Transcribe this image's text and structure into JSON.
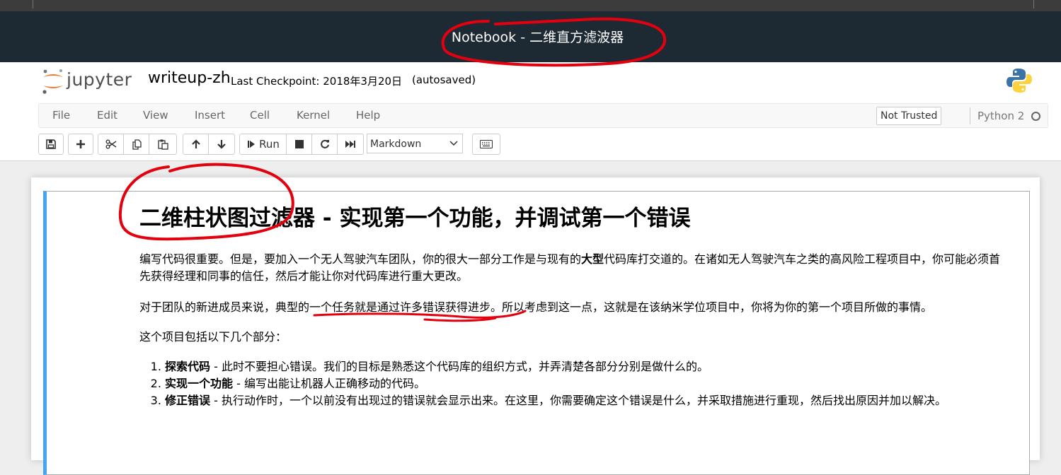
{
  "window": {
    "title": "Notebook - 二维直方滤波器"
  },
  "header": {
    "logo_text": "jupyter",
    "notebook_name": "writeup-zh",
    "checkpoint": "Last Checkpoint: 2018年3月20日",
    "autosave": "(autosaved)"
  },
  "menubar": {
    "items": [
      "File",
      "Edit",
      "View",
      "Insert",
      "Cell",
      "Kernel",
      "Help"
    ],
    "trust_label": "Not Trusted",
    "kernel_name": "Python 2"
  },
  "toolbar": {
    "run_label": "Run",
    "cell_type": "Markdown",
    "icons": [
      "save-icon",
      "plus-icon",
      "cut-icon",
      "copy-icon",
      "paste-icon",
      "arrow-up-icon",
      "arrow-down-icon",
      "step-forward-icon",
      "stop-icon",
      "restart-icon",
      "fast-forward-icon",
      "keyboard-icon"
    ]
  },
  "cell": {
    "heading": "二维柱状图过滤器 - 实现第一个功能，并调试第一个错误",
    "p1_a": "编写代码很重要。但是，要加入一个无人驾驶汽车团队，你的很大一部分工作是与现有的",
    "p1_bold": "大型",
    "p1_b": "代码库打交道的。在诸如无人驾驶汽车之类的高风险工程项目中，你可能必须首先获得经理和同事的信任，然后才能让你对代码库进行重大更改。",
    "p2": "对于团队的新进成员来说，典型的一个任务就是通过许多错误获得进步。所以考虑到这一点，这就是在该纳米学位项目中，你将为你的第一个项目所做的事情。",
    "p3": "这个项目包括以下几个部分：",
    "list": [
      {
        "bold": "探索代码",
        "text": " - 此时不要担心错误。我们的目标是熟悉这个代码库的组织方式，并弄清楚各部分分别是做什么的。"
      },
      {
        "bold": "实现一个功能",
        "text": " - 编写出能让机器人正确移动的代码。"
      },
      {
        "bold": "修正错误",
        "text": " - 执行动作时，一个以前没有出现过的错误就会显示出来。在这里，你需要确定这个错误是什么，并采取措施进行重现，然后找出原因并加以解决。"
      }
    ]
  },
  "colors": {
    "titlebar": "#1e2a33",
    "cell_border_accent": "#42a5f5",
    "annotation": "#e3000f",
    "jupyter_orange": "#f37726"
  }
}
